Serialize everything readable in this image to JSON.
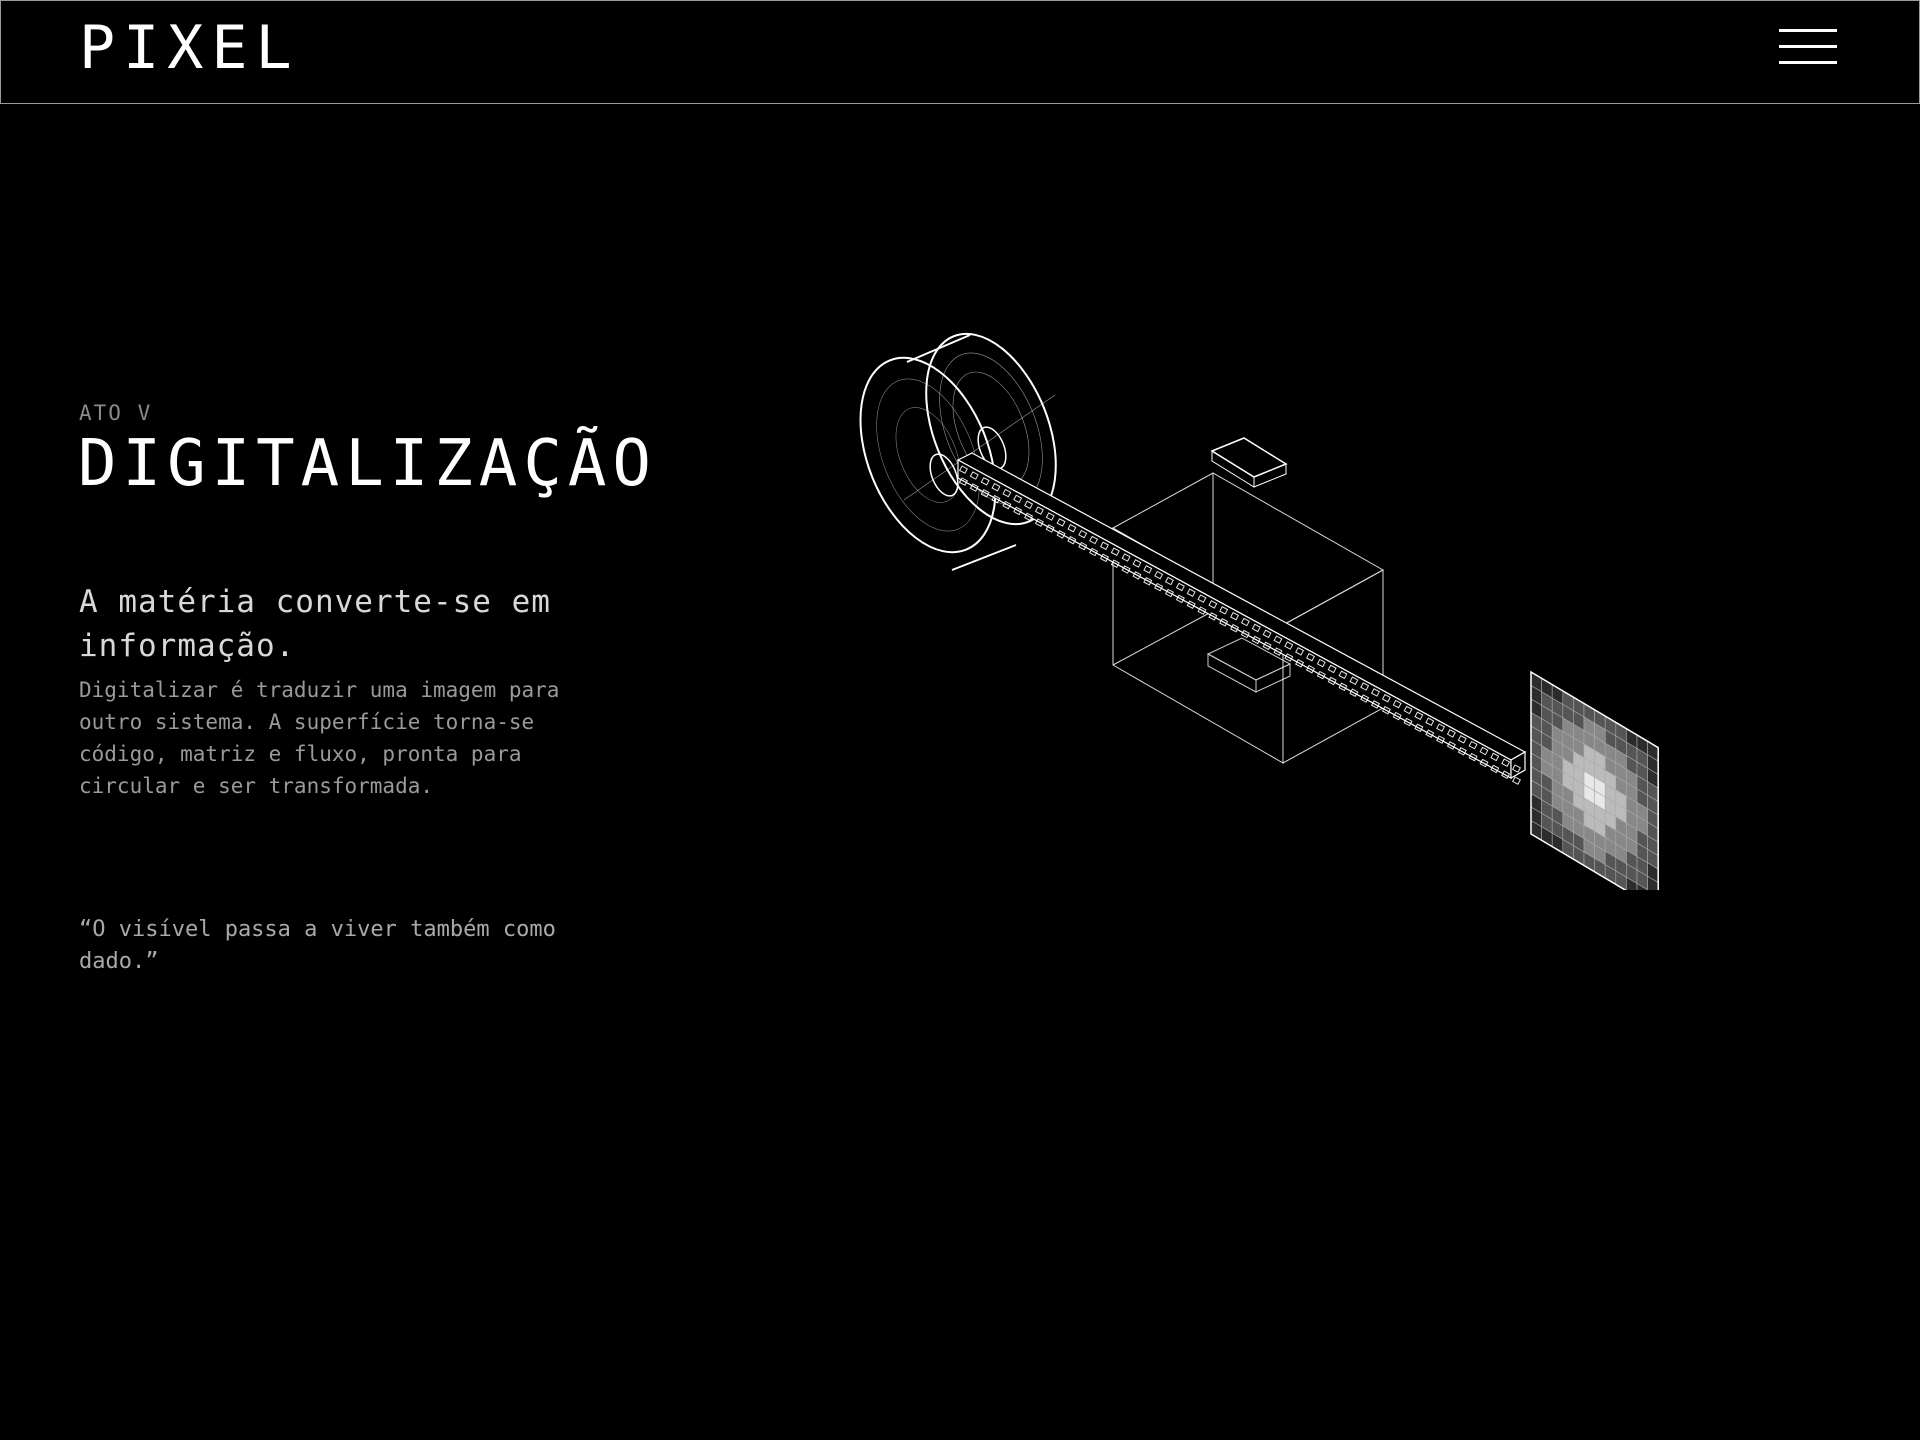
{
  "header": {
    "logo": "PIXEL",
    "menu_icon": "hamburger-menu-icon"
  },
  "hero": {
    "eyebrow": "ATO V",
    "title": "DIGITALIZAÇÃO",
    "lead": "A matéria converte-se em informação.",
    "body": "Digitalizar é traduzir uma imagem para outro sistema. A superfície torna-se código, matriz e fluxo, pronta para circular e ser transformada.",
    "quote": "“O visível passa a viver também como dado.”"
  },
  "illustration": {
    "icon": "film-reel-scanner-pixel-grid-illustration",
    "stroke_color": "#ffffff",
    "pixel_grid_colors": [
      "#2c2c2c",
      "#555555",
      "#888888",
      "#bbbbbb",
      "#e8e8e8"
    ]
  }
}
